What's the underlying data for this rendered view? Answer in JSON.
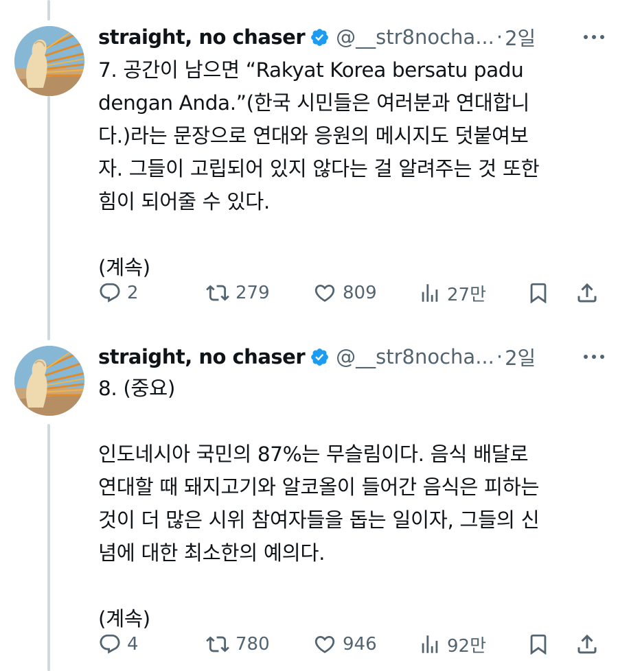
{
  "tweets": [
    {
      "name": "straight, no chaser",
      "handle": "@__str8nocha...",
      "separator": "·",
      "time": "2일",
      "text": "7. 공간이 남으면 “Rakyat Korea bersatu padu\ndengan Anda.”(한국 시민들은 여러분과 연대합니\n다.)라는 문장으로 연대와 응원의 메시지도 덧붙여보\n자. 그들이 고립되어 있지 않다는 걸 알려주는 것 또한\n힘이 되어줄 수 있다.\n\n(계속)",
      "replies": "2",
      "reposts": "279",
      "likes": "809",
      "views": "27만"
    },
    {
      "name": "straight, no chaser",
      "handle": "@__str8nocha...",
      "separator": "·",
      "time": "2일",
      "text": "8. (중요)\n\n인도네시아 국민의 87%는 무슬림이다. 음식 배달로\n연대할 때 돼지고기와 알코올이 들어간 음식은 피하는\n것이 더 많은 시위 참여자들을 돕는 일이자, 그들의 신\n념에 대한 최소한의 예의다.\n\n(계속)",
      "replies": "4",
      "reposts": "780",
      "likes": "946",
      "views": "92만"
    }
  ],
  "icons": [
    "avatar-sculpture",
    "verified-badge-icon",
    "more-icon",
    "reply-icon",
    "repost-icon",
    "like-icon",
    "views-icon",
    "bookmark-icon",
    "share-icon"
  ],
  "colors": {
    "text": "#0f1419",
    "secondary": "#536471",
    "verified": "#1d9bf0",
    "thread_line": "#cfd9de"
  }
}
